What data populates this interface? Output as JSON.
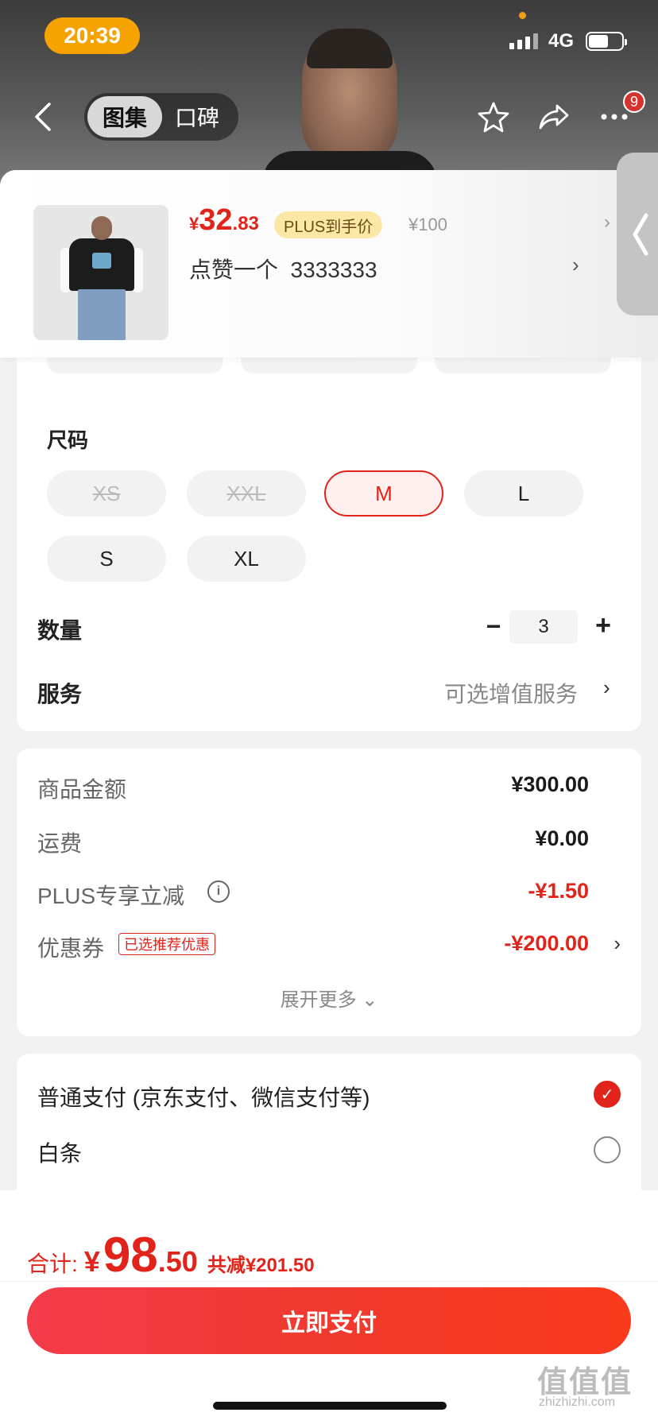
{
  "status_bar": {
    "time": "20:39",
    "network": "4G"
  },
  "nav": {
    "tabs": [
      {
        "label": "图集",
        "active": true
      },
      {
        "label": "口碑",
        "active": false
      }
    ],
    "more_badge": "9"
  },
  "product": {
    "price_symbol": "¥",
    "price_int": "32",
    "price_dec": ".83",
    "plus_tag": "PLUS到手价",
    "original_price": "¥100",
    "variant_text": "点赞一个  3333333"
  },
  "spec": {
    "size_title": "尺码",
    "sizes": [
      {
        "label": "XS",
        "state": "disabled"
      },
      {
        "label": "XXL",
        "state": "disabled"
      },
      {
        "label": "M",
        "state": "selected"
      },
      {
        "label": "L",
        "state": "normal"
      },
      {
        "label": "S",
        "state": "normal"
      },
      {
        "label": "XL",
        "state": "normal"
      }
    ],
    "quantity_label": "数量",
    "quantity_value": "3",
    "minus": "−",
    "plus": "+",
    "service_label": "服务",
    "service_value": "可选增值服务"
  },
  "price_detail": {
    "goods_label": "商品金额",
    "goods_value": "¥300.00",
    "shipping_label": "运费",
    "shipping_value": "¥0.00",
    "plus_discount_label": "PLUS专享立减",
    "plus_discount_value": "-¥1.50",
    "coupon_label": "优惠券",
    "coupon_tag": "已选推荐优惠",
    "coupon_value": "-¥200.00",
    "expand_label": "展开更多 ⌄"
  },
  "payment": {
    "options": [
      {
        "label": "普通支付 (京东支付、微信支付等)",
        "checked": true
      },
      {
        "label": "白条",
        "checked": false
      }
    ]
  },
  "footer": {
    "total_label": "合计:",
    "total_symbol": "¥",
    "total_int": "98",
    "total_dec": ".50",
    "total_saving": "共减¥201.50",
    "pay_button": "立即支付"
  },
  "watermark": {
    "main": "值值值",
    "sub": "zhizhizhi.com"
  },
  "colors": {
    "accent": "#e2231a",
    "plus_tag_bg": "#fbe7a6",
    "status_time_bg": "#f5a300"
  },
  "icons": [
    "back-icon",
    "star-icon",
    "share-icon",
    "more-icon",
    "chevron-right-icon",
    "info-icon",
    "check-icon"
  ]
}
